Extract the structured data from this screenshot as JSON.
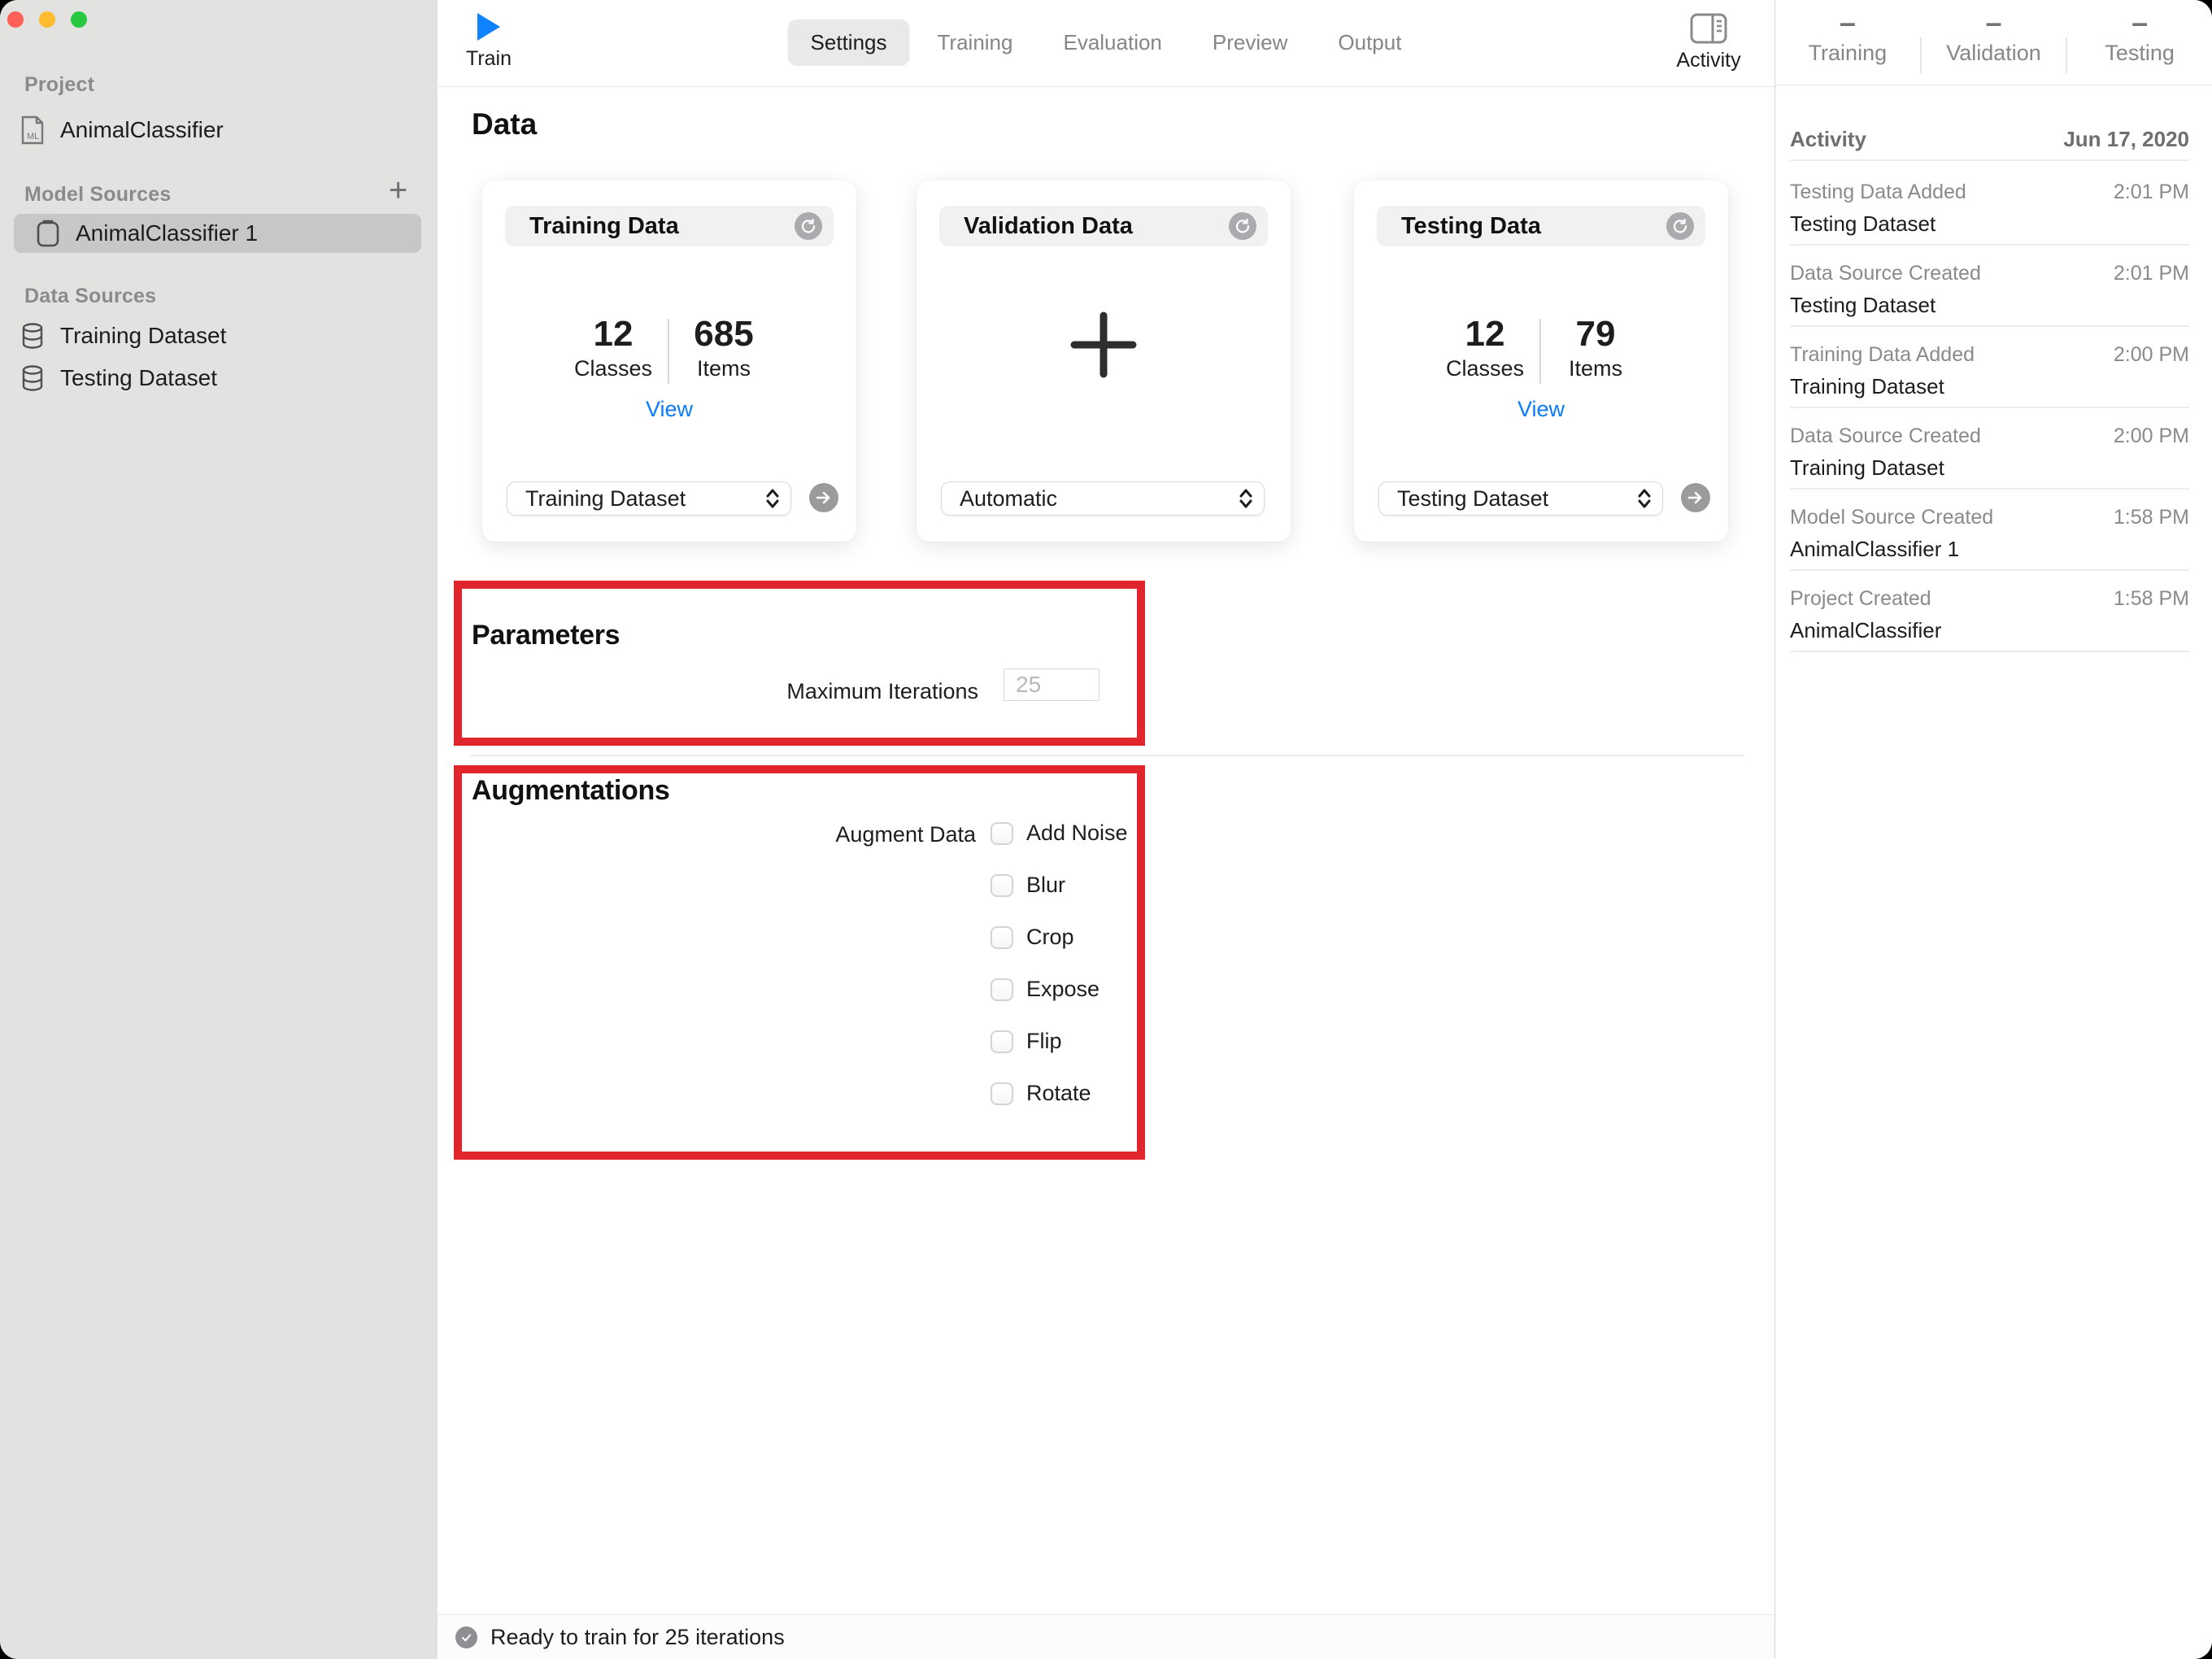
{
  "sidebar": {
    "sections": [
      {
        "label": "Project",
        "items": [
          {
            "label": "AnimalClassifier",
            "icon": "ml-document-icon"
          }
        ]
      },
      {
        "label": "Model Sources",
        "add_button": "+",
        "items": [
          {
            "label": "AnimalClassifier 1",
            "icon": "model-document-icon",
            "selected": true
          }
        ]
      },
      {
        "label": "Data Sources",
        "items": [
          {
            "label": "Training Dataset",
            "icon": "database-icon"
          },
          {
            "label": "Testing Dataset",
            "icon": "database-icon"
          }
        ]
      }
    ]
  },
  "toolbar": {
    "train_label": "Train",
    "tabs": [
      "Settings",
      "Training",
      "Evaluation",
      "Preview",
      "Output"
    ],
    "active_tab": "Settings",
    "activity_label": "Activity"
  },
  "main": {
    "heading": "Data",
    "cards": [
      {
        "title": "Training Data",
        "classes_value": "12",
        "classes_label": "Classes",
        "items_value": "685",
        "items_label": "Items",
        "view_label": "View",
        "dropdown_value": "Training Dataset"
      },
      {
        "title": "Validation Data",
        "dropdown_value": "Automatic"
      },
      {
        "title": "Testing Data",
        "classes_value": "12",
        "classes_label": "Classes",
        "items_value": "79",
        "items_label": "Items",
        "view_label": "View",
        "dropdown_value": "Testing Dataset"
      }
    ],
    "parameters": {
      "heading": "Parameters",
      "iterations_label": "Maximum Iterations",
      "iterations_value": "25"
    },
    "augmentations": {
      "heading": "Augmentations",
      "augment_label": "Augment Data",
      "options": [
        "Add Noise",
        "Blur",
        "Crop",
        "Expose",
        "Flip",
        "Rotate"
      ]
    },
    "status_bar": {
      "text": "Ready to train for 25 iterations"
    }
  },
  "right_panel": {
    "stats": [
      {
        "value": "–",
        "label": "Training"
      },
      {
        "value": "–",
        "label": "Validation"
      },
      {
        "value": "–",
        "label": "Testing"
      }
    ],
    "activity": {
      "header": "Activity",
      "date": "Jun 17, 2020",
      "entries": [
        {
          "title": "Testing Data Added",
          "name": "Testing Dataset",
          "time": "2:01 PM"
        },
        {
          "title": "Data Source Created",
          "name": "Testing Dataset",
          "time": "2:01 PM"
        },
        {
          "title": "Training Data Added",
          "name": "Training Dataset",
          "time": "2:00 PM"
        },
        {
          "title": "Data Source Created",
          "name": "Training Dataset",
          "time": "2:00 PM"
        },
        {
          "title": "Model Source Created",
          "name": "AnimalClassifier 1",
          "time": "1:58 PM"
        },
        {
          "title": "Project Created",
          "name": "AnimalClassifier",
          "time": "1:58 PM"
        }
      ]
    }
  },
  "colors": {
    "accent_blue": "#0f82ff",
    "link_blue": "#0a7aff",
    "annotation_red": "#e0262c",
    "sidebar_bg": "#e2e2e1",
    "selected_row_gray": "#c7c7c7",
    "traffic_red": "#ff5f57",
    "traffic_yellow": "#febc2e",
    "traffic_green": "#28c840"
  }
}
